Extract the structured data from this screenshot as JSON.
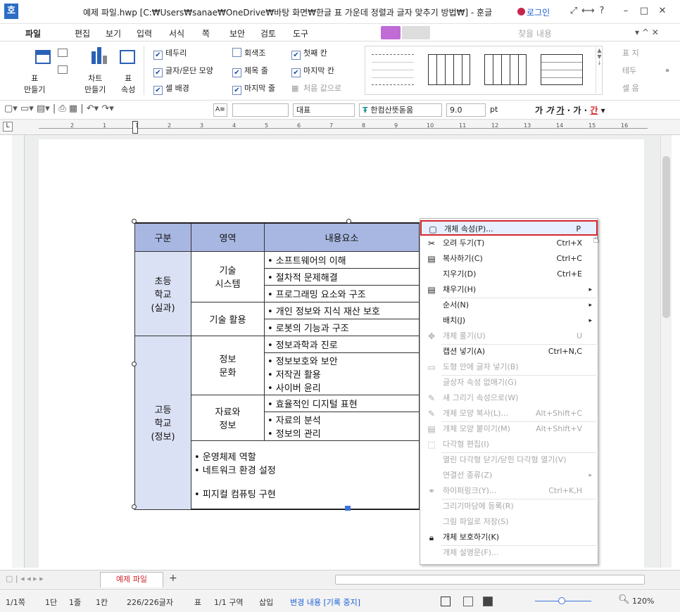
{
  "window": {
    "logo": "호",
    "title": "예제 파일.hwp [C:₩Users₩sanae₩OneDrive₩바탕 화면₩한글 표 가운데 정렬과 글자 맞추기 방법₩] - 훈글",
    "login": "로그인",
    "min": "–",
    "max": "□",
    "close": "✕",
    "help": "?"
  },
  "menu": [
    "파일",
    "편집",
    "보기",
    "입력",
    "서식",
    "쪽",
    "보안",
    "검토",
    "도구"
  ],
  "find_placeholder": "찾을 내용",
  "ribbon": {
    "table_make": "표\n만들기",
    "chart_make": "차트\n만들기",
    "table_prop": "표\n속성",
    "checks": [
      [
        "테두리",
        true
      ],
      [
        "글자/문단 모양",
        true
      ],
      [
        "셀 배경",
        true
      ],
      [
        "회색조",
        false
      ],
      [
        "제목 줄",
        true
      ],
      [
        "마지막 줄",
        true
      ],
      [
        "첫째 칸",
        true
      ],
      [
        "마지막 칸",
        true
      ],
      [
        "처음 값으로",
        false
      ]
    ],
    "right": [
      "표 지",
      "테두",
      "셀 음"
    ]
  },
  "toolbar": {
    "style": "대표",
    "font": "한컴산뜻돋움",
    "size": "9.0",
    "unit": "pt"
  },
  "ruler": [
    "2",
    "1",
    "1",
    "2",
    "3",
    "4",
    "5",
    "6",
    "7",
    "8",
    "9",
    "10",
    "11",
    "12",
    "13",
    "14",
    "15",
    "16"
  ],
  "table": {
    "headers": [
      "구분",
      "영역",
      "내용요소"
    ],
    "elem": "초등\n학교\n(실과)",
    "elem_area1": "기술\n시스템",
    "elem_area1_items": [
      "• 소프트웨어의 이해",
      "• 절차적 문제해결",
      "• 프로그래밍 요소와 구조"
    ],
    "elem_area2": "기술 활용",
    "elem_area2_items": [
      "• 개인 정보와 지식 재산 보호",
      "• 로봇의 기능과 구조"
    ],
    "high": "고등\n학교\n(정보)",
    "high_area1": "정보\n문화",
    "high_area1_items": [
      "• 정보과학과 진로",
      "• 정보보호와 보안\n• 저작권 활용\n• 사이버 윤리"
    ],
    "high_area2": "자료와\n정보",
    "high_area2_items": [
      "• 효율적인 디지털 표현",
      "• 자료의 분석\n• 정보의 관리"
    ],
    "high_area3_items": "• 운영체제 역할\n• 네트워크 환경 설정\n\n• 피지컬 컴퓨팅 구현"
  },
  "context_menu": [
    {
      "label": "개체 속성(P)...",
      "shortcut": "P",
      "enabled": true,
      "icon": "object-props-icon"
    },
    {
      "label": "오려 두기(T)",
      "shortcut": "Ctrl+X",
      "enabled": true,
      "icon": "scissors-icon"
    },
    {
      "label": "복사하기(C)",
      "shortcut": "Ctrl+C",
      "enabled": true,
      "icon": "copy-icon"
    },
    {
      "label": "지우기(D)",
      "shortcut": "Ctrl+E",
      "enabled": true,
      "icon": ""
    },
    {
      "label": "채우기(H)",
      "shortcut": "",
      "enabled": true,
      "icon": "fill-icon",
      "sub": true
    },
    {
      "label": "순서(N)",
      "shortcut": "",
      "enabled": true,
      "icon": "",
      "sub": true
    },
    {
      "label": "배치(J)",
      "shortcut": "",
      "enabled": true,
      "icon": "",
      "sub": true
    },
    {
      "label": "개체 풀기(U)",
      "shortcut": "U",
      "enabled": false,
      "icon": "ungroup-icon"
    },
    {
      "label": "캡션 넣기(A)",
      "shortcut": "Ctrl+N,C",
      "enabled": true,
      "icon": ""
    },
    {
      "label": "도형 안에 글자 넣기(B)",
      "shortcut": "",
      "enabled": false,
      "icon": "text-in-shape-icon"
    },
    {
      "label": "글상자 속성 없애기(G)",
      "shortcut": "",
      "enabled": false,
      "icon": ""
    },
    {
      "label": "새 그리기 속성으로(W)",
      "shortcut": "",
      "enabled": false,
      "icon": "new-draw-icon"
    },
    {
      "label": "개체 모양 복사(L)...",
      "shortcut": "Alt+Shift+C",
      "enabled": false,
      "icon": "copy-shape-icon"
    },
    {
      "label": "개체 모양 붙이기(M)",
      "shortcut": "Alt+Shift+V",
      "enabled": false,
      "icon": "paste-shape-icon"
    },
    {
      "label": "다각형 편집(I)",
      "shortcut": "",
      "enabled": false,
      "icon": "polygon-icon"
    },
    {
      "label": "열린 다각형 닫기/닫힌 다각형 열기(V)",
      "shortcut": "",
      "enabled": false,
      "icon": ""
    },
    {
      "label": "연결선 종류(Z)",
      "shortcut": "",
      "enabled": false,
      "icon": "",
      "sub": true
    },
    {
      "label": "하이퍼링크(Y)...",
      "shortcut": "Ctrl+K,H",
      "enabled": false,
      "icon": "link-icon"
    },
    {
      "label": "그리기마당에 등록(R)",
      "shortcut": "",
      "enabled": false,
      "icon": ""
    },
    {
      "label": "그림 파일로 저장(S)",
      "shortcut": "",
      "enabled": false,
      "icon": ""
    },
    {
      "label": "개체 보호하기(K)",
      "shortcut": "",
      "enabled": true,
      "icon": "lock-icon"
    },
    {
      "label": "개체 설명문(F)...",
      "shortcut": "",
      "enabled": false,
      "icon": ""
    }
  ],
  "tab": {
    "name": "예제 파일",
    "add": "+"
  },
  "status": [
    "1/1쪽",
    "1단",
    "1줄",
    "1칸",
    "226/226글자",
    "표",
    "1/1 구역",
    "삽입",
    "변경 내용 [기록 중지]",
    "120%"
  ],
  "colors": {
    "accent": "#1a5fd6",
    "highlight": "#d6272f",
    "table_head": "#a8b7e2",
    "table_cat": "#dbe1f4"
  }
}
